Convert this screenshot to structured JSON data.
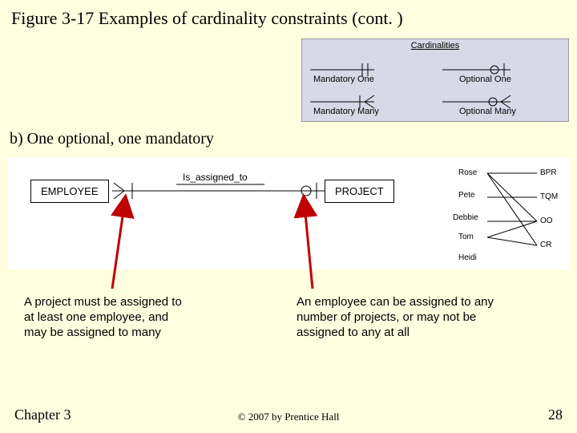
{
  "title": "Figure 3-17 Examples of cardinality constraints (cont. )",
  "subtitle": "b) One optional, one mandatory",
  "legend": {
    "heading": "Cardinalities",
    "items": [
      "Mandatory One",
      "Optional One",
      "Mandatory Many",
      "Optional Many"
    ]
  },
  "entities": {
    "left": "EMPLOYEE",
    "right": "PROJECT",
    "relationship": "Is_assigned_to"
  },
  "instances": {
    "employees": [
      "Rose",
      "Pete",
      "Debbie",
      "Tom",
      "Heidi"
    ],
    "projects": [
      "BPR",
      "TQM",
      "OO",
      "CR"
    ]
  },
  "captions": {
    "left": "A project must be assigned to at least one employee, and may be assigned to many",
    "right": "An employee can be assigned to any number of projects, or may not be assigned to any at all"
  },
  "footer": {
    "chapter": "Chapter 3",
    "copyright": "© 2007 by Prentice Hall",
    "page": "28"
  }
}
